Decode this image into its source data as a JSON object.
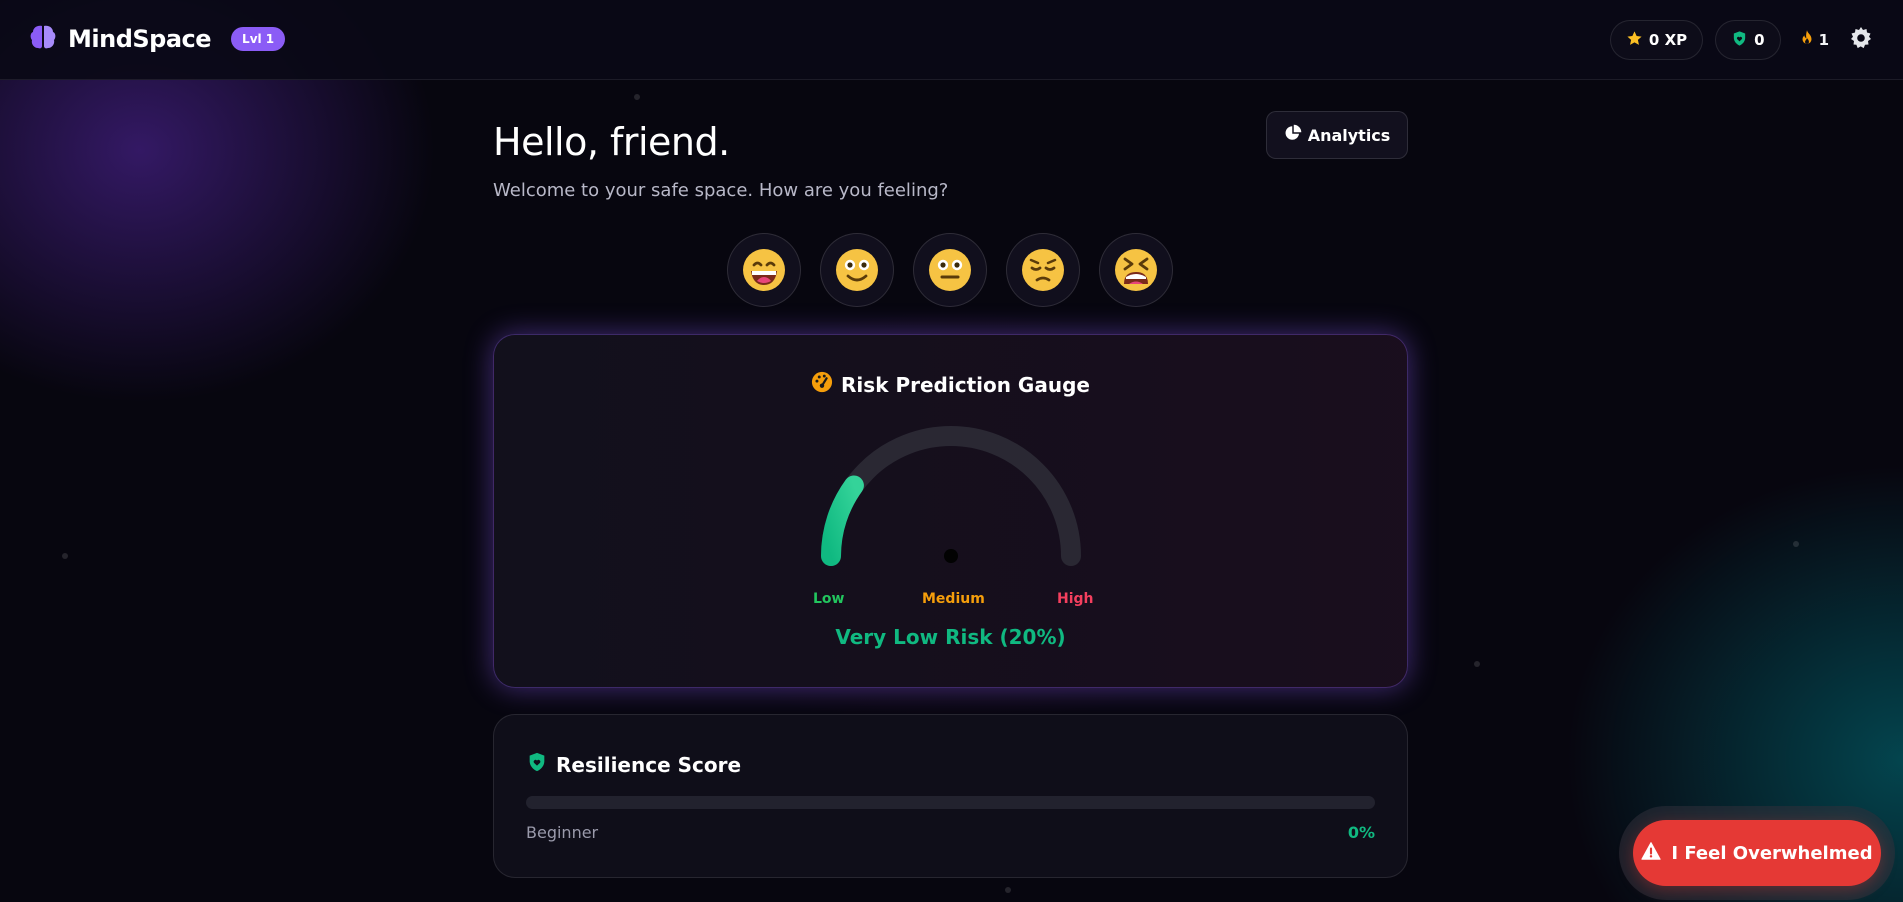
{
  "colors": {
    "accent": "#8b5cf6",
    "success": "#10b981",
    "warning": "#f59e0b",
    "danger": "#f43f5e",
    "alert_button": "#e53935"
  },
  "header": {
    "app_name": "MindSpace",
    "level_badge": "Lvl 1",
    "xp": "0 XP",
    "shields": "0",
    "streak": "1",
    "icons": [
      "brain-icon",
      "star-icon",
      "shield-heart-icon",
      "flame-icon",
      "gear-icon"
    ]
  },
  "main": {
    "greeting": "Hello, friend.",
    "subtitle": "Welcome to your safe space. How are you feeling?",
    "analytics_label": "Analytics",
    "moods": [
      "😄",
      "🙂",
      "😐",
      "😔",
      "😫"
    ]
  },
  "gauge": {
    "title": "Risk Prediction Gauge",
    "labels": {
      "low": "Low",
      "medium": "Medium",
      "high": "High"
    },
    "value_percent": 20,
    "result_text": "Very Low Risk (20%)"
  },
  "resilience": {
    "title": "Resilience Score",
    "level": "Beginner",
    "percent_text": "0%",
    "value_percent": 0
  },
  "alert": {
    "label": "I Feel Overwhelmed"
  }
}
